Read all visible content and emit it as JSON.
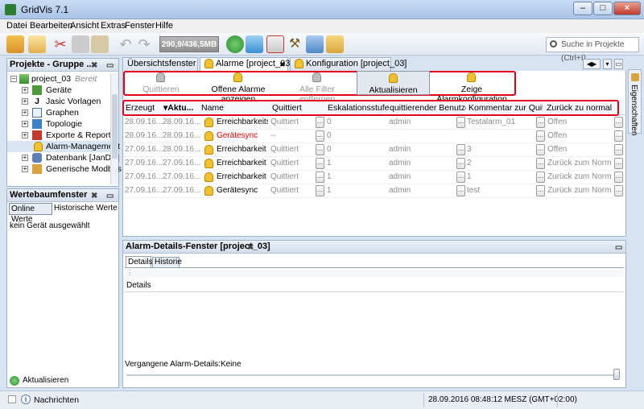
{
  "window": {
    "title": "GridVis 7.1"
  },
  "menu": [
    "Datei",
    "Bearbeiten",
    "Ansicht",
    "Extras",
    "Fenster",
    "Hilfe"
  ],
  "toolbar": {
    "memory": "290,9/436,5MB",
    "search_placeholder": "Suche in Projekte (Ctrl+I)"
  },
  "projects_panel": {
    "title": "Projekte - Gruppe ...",
    "project": {
      "name": "project_03",
      "state": "Bereit"
    },
    "items": [
      "Geräte",
      "Jasic Vorlagen",
      "Graphen",
      "Topologie",
      "Exporte & Reporte",
      "Alarm-Management",
      "Datenbank [JanDB]",
      "Generische Modbus P"
    ]
  },
  "value_panel": {
    "title": "Wertebaumfenster",
    "tabs": [
      "Online Werte",
      "Historische Werte"
    ],
    "empty_text": "kein Gerät ausgewählt",
    "refresh_label": "Aktualisieren"
  },
  "editor_tabs": [
    "Übersichtsfenster",
    "Alarme [project_03]",
    "Konfiguration [project_03]"
  ],
  "actions": {
    "quittieren": "Quittieren",
    "offene": "Offene Alarme anzeigen",
    "filter": "Alle Filter entfernen",
    "aktualisieren": "Aktualisieren",
    "konfig": "Zeige Alarmkonfiguration"
  },
  "columns": [
    "Erzeugt",
    "Aktu...",
    "Name",
    "Quittiert",
    "Eskalationsstufe",
    "quittierender Benutzer",
    "Kommentar zur Quitti...",
    "Zurück zu normal"
  ],
  "rows": [
    {
      "erzeugt": "28.09.16...",
      "aktu": "28.09.16...",
      "name": "Erreichbarkeitstest",
      "name_style": "black",
      "quittiert": "Quittiert",
      "eskalation": "0",
      "benutzer": "admin",
      "kommentar": "Testalarm_01",
      "normal": "Offen"
    },
    {
      "erzeugt": "28.09.16...",
      "aktu": "28.09.16...",
      "name": "Gerätesync",
      "name_style": "red",
      "quittiert": "--",
      "eskalation": "0",
      "benutzer": "",
      "kommentar": "",
      "normal": "Offen"
    },
    {
      "erzeugt": "27.09.16...",
      "aktu": "28.09.16...",
      "name": "Erreichbarkeit",
      "name_style": "black",
      "quittiert": "Quittiert",
      "eskalation": "0",
      "benutzer": "admin",
      "kommentar": "3",
      "normal": "Offen"
    },
    {
      "erzeugt": "27.09.16...",
      "aktu": "27.09.16...",
      "name": "Erreichbarkeit",
      "name_style": "black",
      "quittiert": "Quittiert",
      "eskalation": "1",
      "benutzer": "admin",
      "kommentar": "2",
      "normal": "Zurück zum Normalz..."
    },
    {
      "erzeugt": "27.09.16...",
      "aktu": "27.09.16...",
      "name": "Erreichbarkeit",
      "name_style": "black",
      "quittiert": "Quittiert",
      "eskalation": "1",
      "benutzer": "admin",
      "kommentar": "1",
      "normal": "Zurück zum Normalz..."
    },
    {
      "erzeugt": "27.09.16...",
      "aktu": "27.09.16...",
      "name": "Gerätesync",
      "name_style": "black",
      "quittiert": "Quittiert",
      "eskalation": "1",
      "benutzer": "admin",
      "kommentar": "test",
      "normal": "Zurück zum Normalz..."
    }
  ],
  "details_panel": {
    "title": "Alarm-Details-Fenster [project_03]",
    "tabs": [
      "Details",
      "Historie"
    ],
    "section": "Details",
    "past": "Vergangene Alarm-Details:Keine"
  },
  "side_tab": "Eigenschaften",
  "statusbar": {
    "messages": "Nachrichten",
    "datetime": "28.09.2016 08:48:12 MESZ (GMT+02:00)"
  }
}
